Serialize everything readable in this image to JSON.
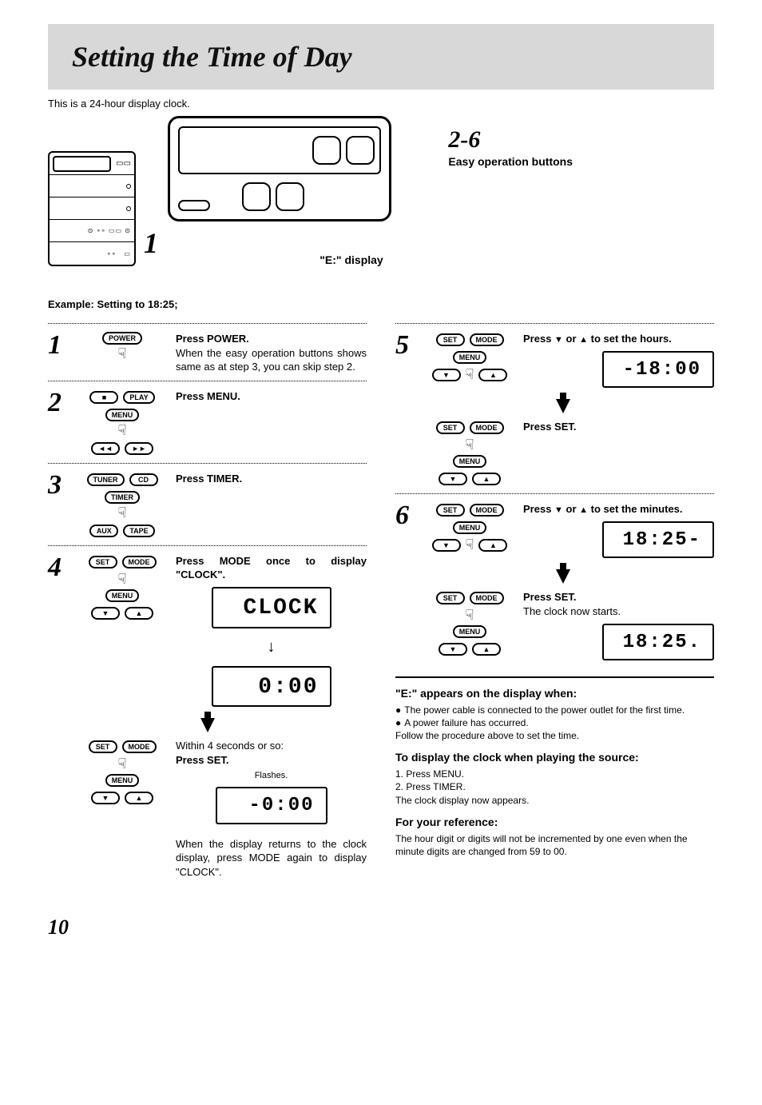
{
  "title": "Setting the Time of Day",
  "intro": "This is a 24-hour display clock.",
  "diagram": {
    "step1_marker": "1",
    "range_marker": "2-6",
    "easy_buttons_label": "Easy operation buttons",
    "e_display_label": "\"E:\" display"
  },
  "example_label": "Example:",
  "example_value": "Setting to 18:25;",
  "steps_left": [
    {
      "num": "1",
      "head": "Press POWER.",
      "body": "When the easy operation buttons shows same as at step 3, you can skip step 2.",
      "icons": [
        "POWER"
      ]
    },
    {
      "num": "2",
      "head": "Press MENU.",
      "body": "",
      "icons": [
        "■",
        "PLAY",
        "MENU",
        "◄◄",
        "►►"
      ]
    },
    {
      "num": "3",
      "head": "Press TIMER.",
      "body": "",
      "icons": [
        "TUNER",
        "CD",
        "TIMER",
        "AUX",
        "TAPE"
      ]
    },
    {
      "num": "4",
      "head": "Press MODE once to display \"CLOCK\".",
      "body": "",
      "icons": [
        "SET",
        "MODE",
        "MENU",
        "▼",
        "▲"
      ]
    }
  ],
  "lcd_clock": "CLOCK",
  "lcd_000": "0:00",
  "lcd_000_flash": "-0:00",
  "within_label": "Within 4 seconds or so:",
  "press_set_label": "Press SET.",
  "flashes_label": "Flashes.",
  "return_note": "When the display returns to the clock display, press MODE again to display \"CLOCK\".",
  "steps_right": [
    {
      "num": "5",
      "head_pre": "Press ",
      "head_mid": " or ",
      "head_post": " to set the hours.",
      "lcd": "-18:00",
      "set_head": "Press SET.",
      "icons": [
        "SET",
        "MODE",
        "MENU",
        "▼",
        "▲"
      ]
    },
    {
      "num": "6",
      "head_pre": "Press ",
      "head_mid": " or ",
      "head_post": " to set the minutes.",
      "lcd": "18:25-",
      "set_head": "Press SET.",
      "set_body": "The clock now starts.",
      "lcd2": "18:25.",
      "icons": [
        "SET",
        "MODE",
        "MENU",
        "▼",
        "▲"
      ]
    }
  ],
  "notes": {
    "e_head": "\"E:\" appears on the display when:",
    "e_b1": "The power cable is connected to the power outlet for the first time.",
    "e_b2": "A power failure has occurred.",
    "e_foot": "Follow the procedure above to set the time.",
    "disp_head": "To display the clock when playing the source:",
    "disp_1": "1.  Press MENU.",
    "disp_2": "2.  Press TIMER.",
    "disp_foot": "The clock display now appears.",
    "ref_head": "For your reference:",
    "ref_body": "The hour digit or digits will not be incremented by one even when the minute digits are changed from 59 to 00."
  },
  "page_number": "10"
}
